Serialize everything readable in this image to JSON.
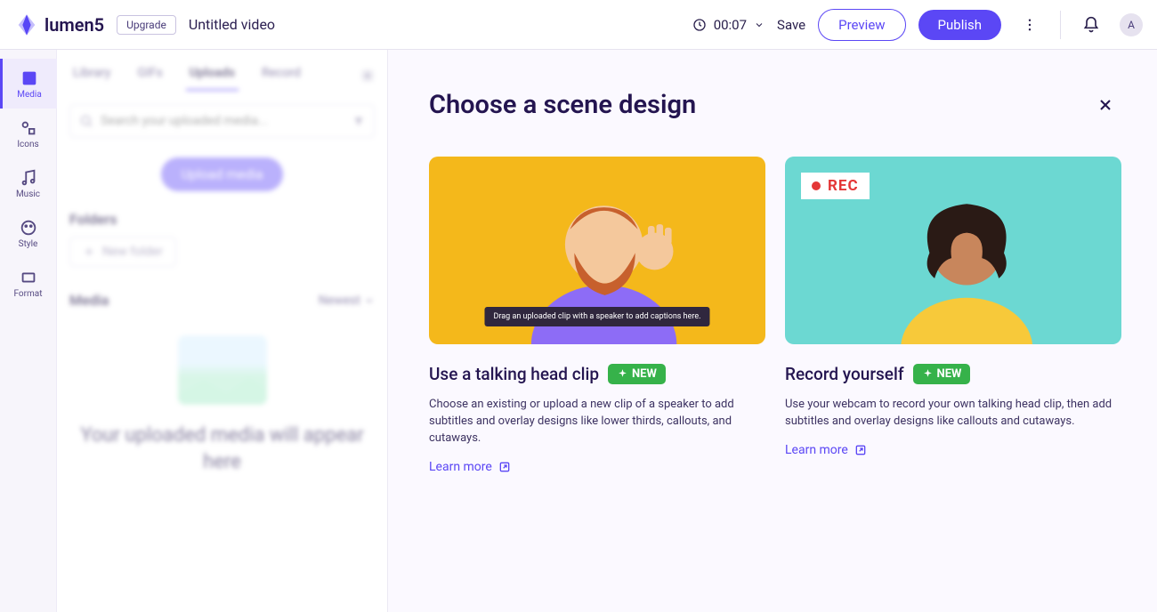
{
  "header": {
    "logo": "lumen5",
    "upgrade": "Upgrade",
    "title": "Untitled video",
    "duration": "00:07",
    "save": "Save",
    "preview": "Preview",
    "publish": "Publish",
    "avatar": "A"
  },
  "sidebar": {
    "items": [
      {
        "label": "Media"
      },
      {
        "label": "Icons"
      },
      {
        "label": "Music"
      },
      {
        "label": "Style"
      },
      {
        "label": "Format"
      }
    ]
  },
  "panel": {
    "tabs": [
      {
        "label": "Library"
      },
      {
        "label": "GIFs"
      },
      {
        "label": "Uploads"
      },
      {
        "label": "Record"
      }
    ],
    "search_placeholder": "Search your uploaded media...",
    "upload": "Upload media",
    "folders_hdr": "Folders",
    "new_folder": "New folder",
    "media_hdr": "Media",
    "sort": "Newest",
    "empty": "Your uploaded media will appear here"
  },
  "modal": {
    "title": "Choose a scene design",
    "cards": [
      {
        "title": "Use a talking head clip",
        "badge": "NEW",
        "desc": "Choose an existing or upload a new clip of a speaker to add subtitles and overlay designs like lower thirds, callouts, and cutaways.",
        "caption": "Drag an uploaded clip with a speaker to add captions here.",
        "learn": "Learn more",
        "rec": ""
      },
      {
        "title": "Record yourself",
        "badge": "NEW",
        "desc": "Use your webcam to record your own talking head clip, then add subtitles and overlay designs like callouts and cutaways.",
        "caption": "",
        "learn": "Learn more",
        "rec": "REC"
      }
    ]
  }
}
